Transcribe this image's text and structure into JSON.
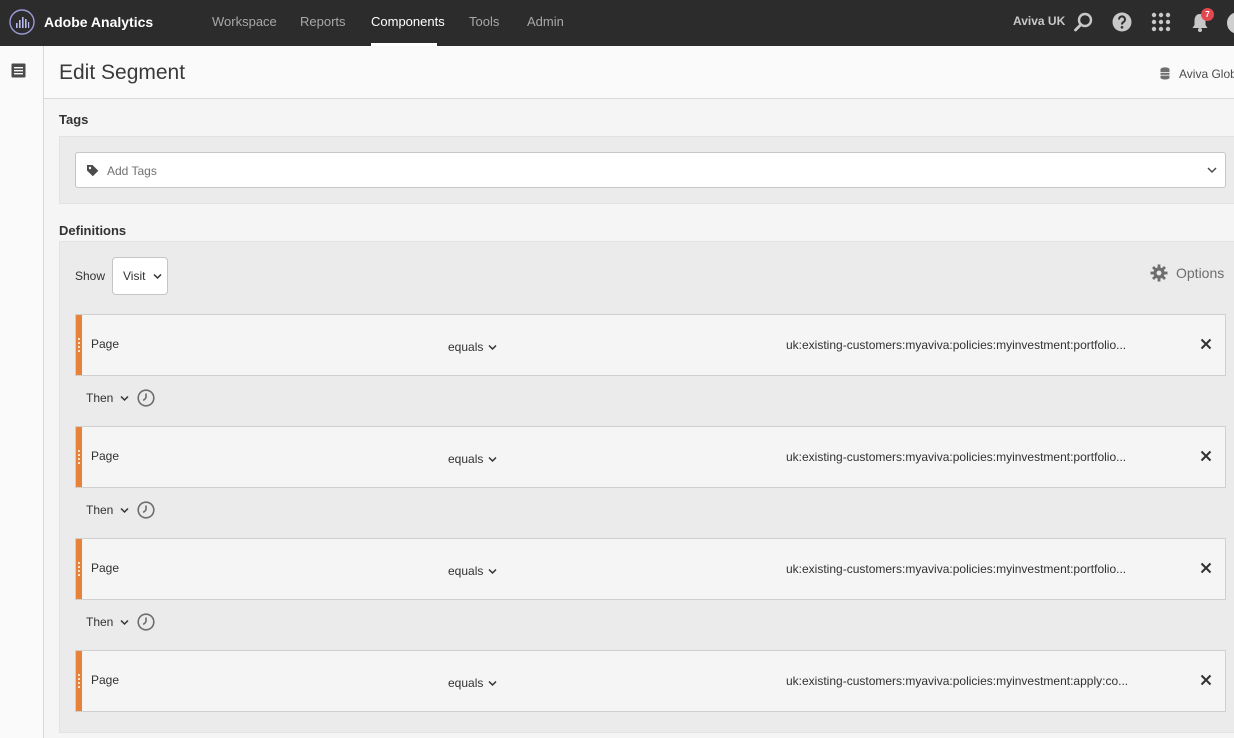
{
  "app": {
    "name": "Adobe Analytics"
  },
  "nav": {
    "workspace": "Workspace",
    "reports": "Reports",
    "components": "Components",
    "tools": "Tools",
    "admin": "Admin"
  },
  "topbar": {
    "org": "Aviva UK",
    "notification_count": "7",
    "icons": [
      "search-icon",
      "help-icon",
      "apps-grid-icon",
      "bell-icon"
    ]
  },
  "header": {
    "title": "Edit Segment",
    "report_suite": "Aviva Glob"
  },
  "tags": {
    "label": "Tags",
    "placeholder": "Add Tags"
  },
  "definitions": {
    "label": "Definitions",
    "show_label": "Show",
    "show_value": "Visit",
    "options_label": "Options",
    "rules": [
      {
        "dimension": "Page",
        "operator": "equals",
        "value": "uk:existing-customers:myaviva:policies:myinvestment:portfolio..."
      },
      {
        "dimension": "Page",
        "operator": "equals",
        "value": "uk:existing-customers:myaviva:policies:myinvestment:portfolio..."
      },
      {
        "dimension": "Page",
        "operator": "equals",
        "value": "uk:existing-customers:myaviva:policies:myinvestment:portfolio..."
      },
      {
        "dimension": "Page",
        "operator": "equals",
        "value": "uk:existing-customers:myaviva:policies:myinvestment:apply:co..."
      }
    ],
    "then_label": "Then"
  },
  "colors": {
    "topbar": "#2c2c2c",
    "rule_accent": "#e7823a",
    "badge": "#e34850"
  }
}
